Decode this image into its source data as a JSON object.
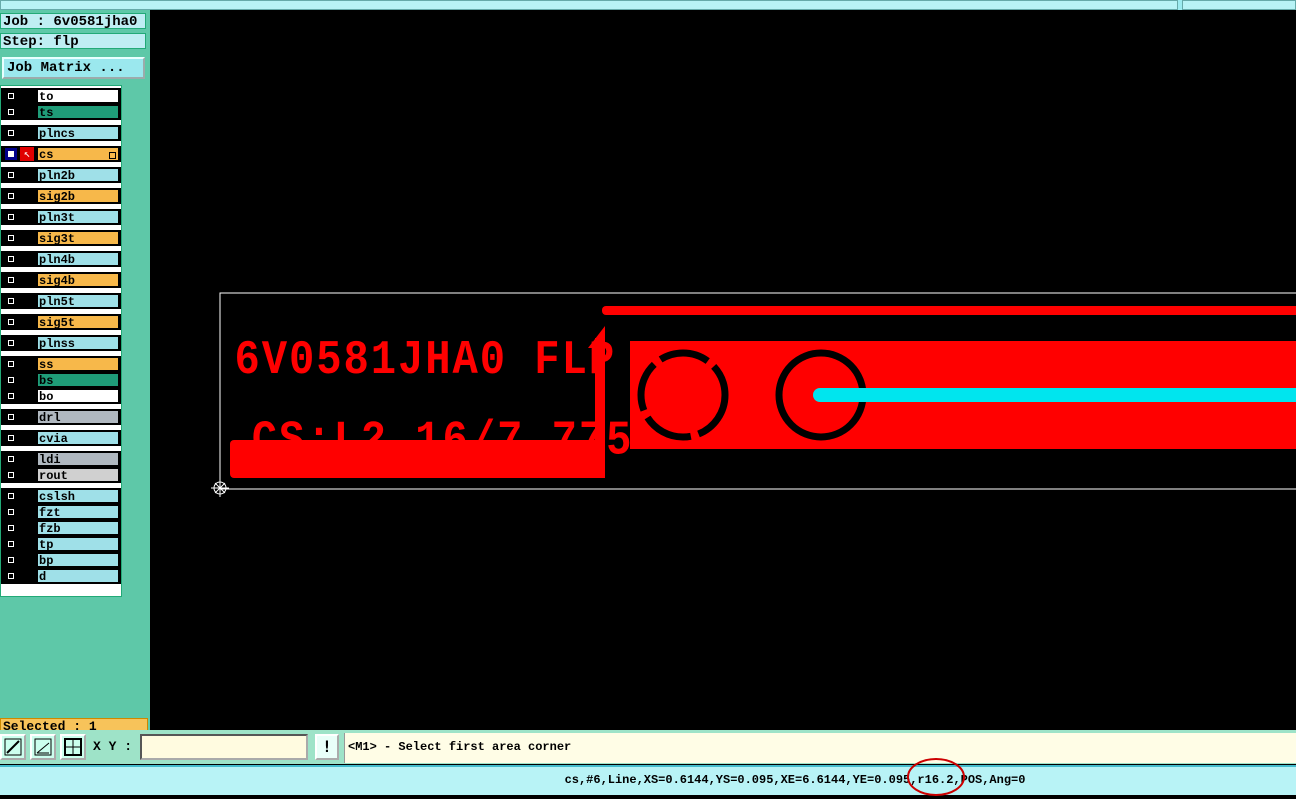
{
  "job": {
    "job_line": "Job : 6v0581jha0",
    "step_line": "Step: flp",
    "matrix_button": "Job Matrix ..."
  },
  "layers": [
    {
      "name": "to",
      "color": "#ffffff",
      "group": 0
    },
    {
      "name": "ts",
      "color": "#1f9c78",
      "group": 0
    },
    {
      "name": "plncs",
      "color": "#9fe0e8",
      "group": 1
    },
    {
      "name": "cs",
      "color": "#f7b84a",
      "group": 2,
      "active": true
    },
    {
      "name": "pln2b",
      "color": "#9fe0e8",
      "group": 3
    },
    {
      "name": "sig2b",
      "color": "#f7b84a",
      "group": 4
    },
    {
      "name": "pln3t",
      "color": "#9fe0e8",
      "group": 5
    },
    {
      "name": "sig3t",
      "color": "#f7b84a",
      "group": 6
    },
    {
      "name": "pln4b",
      "color": "#9fe0e8",
      "group": 7
    },
    {
      "name": "sig4b",
      "color": "#f7b84a",
      "group": 8
    },
    {
      "name": "pln5t",
      "color": "#9fe0e8",
      "group": 9
    },
    {
      "name": "sig5t",
      "color": "#f7b84a",
      "group": 10
    },
    {
      "name": "plnss",
      "color": "#9fe0e8",
      "group": 11
    },
    {
      "name": "ss",
      "color": "#f7b84a",
      "group": 12
    },
    {
      "name": "bs",
      "color": "#1f9c78",
      "group": 12
    },
    {
      "name": "bo",
      "color": "#ffffff",
      "group": 12
    },
    {
      "name": "drl",
      "color": "#b0b8c0",
      "group": 13
    },
    {
      "name": "cvia",
      "color": "#9fe0e8",
      "group": 14
    },
    {
      "name": "ldi",
      "color": "#b0b8c0",
      "group": 15
    },
    {
      "name": "rout",
      "color": "#d0d0d0",
      "group": 15
    },
    {
      "name": "cslsh",
      "color": "#9fe0e8",
      "group": 16
    },
    {
      "name": "fzt",
      "color": "#9fe0e8",
      "group": 16
    },
    {
      "name": "fzb",
      "color": "#9fe0e8",
      "group": 16
    },
    {
      "name": "tp",
      "color": "#9fe0e8",
      "group": 16
    },
    {
      "name": "bp",
      "color": "#9fe0e8",
      "group": 16
    },
    {
      "name": "d",
      "color": "#9fe0e8",
      "group": 16
    }
  ],
  "selected": "Selected : 1",
  "board": {
    "text_line1": "6V0581JHA0 FLP",
    "text_line2": "CS:L2 16/7.775",
    "copper_color": "#ff0000",
    "trace_color": "#00e5ee",
    "outline_color": "#ffffff"
  },
  "command": {
    "xy_label": "X Y :",
    "xy_value": "",
    "warn_label": "!",
    "prompt_text": "<M1> - Select first area corner"
  },
  "status": {
    "text": "cs,#6,Line,XS=0.6144,YS=0.095,XE=6.6144,YE=0.095,r16.2,POS,Ang=0",
    "highlight_color": "#cc0000"
  },
  "icons": [
    "zoom-area-icon",
    "measure-icon",
    "grid-snap-icon",
    "warning-icon",
    "origin-crosshair-icon"
  ]
}
